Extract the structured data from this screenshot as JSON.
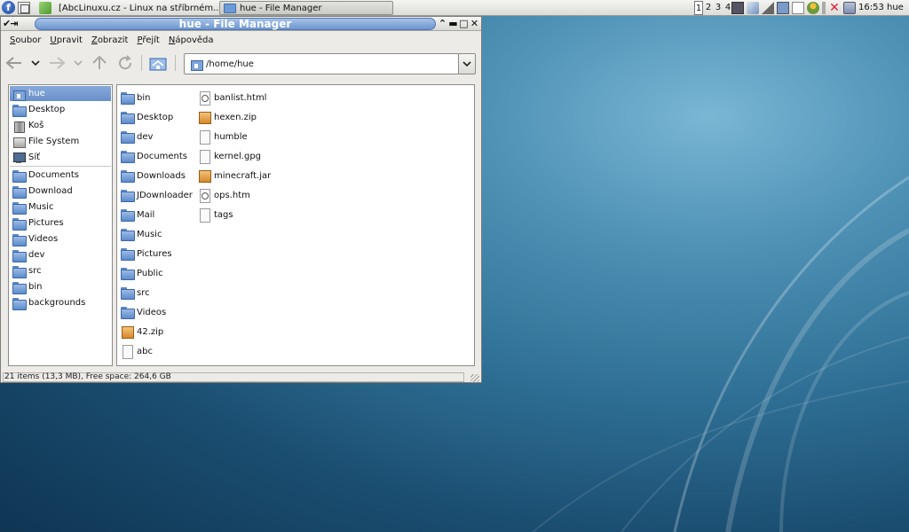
{
  "panel": {
    "menu_logo": "f",
    "taskbar": [
      {
        "label": "[AbcLinuxu.cz - Linux na stříbrném..."
      },
      {
        "label": "hue - File Manager"
      }
    ],
    "workspaces": [
      "1",
      "2",
      "3",
      "4"
    ],
    "active_workspace": "1",
    "clock": "16:53",
    "user": "hue"
  },
  "window": {
    "title": "hue - File Manager",
    "titlebar_left": "✔⇥",
    "buttons": {
      "shade": "⌃",
      "minimize": "▬",
      "maximize": "□",
      "close": "✕"
    }
  },
  "menu": [
    {
      "label": "Soubor",
      "mnemonic": "S",
      "rest": "oubor"
    },
    {
      "label": "Upravit",
      "mnemonic": "U",
      "rest": "pravit"
    },
    {
      "label": "Zobrazit",
      "mnemonic": "Z",
      "rest": "obrazit"
    },
    {
      "label": "Přejít",
      "mnemonic": "P",
      "rest": "řejít"
    },
    {
      "label": "Nápověda",
      "mnemonic": "N",
      "rest": "ápověda"
    }
  ],
  "toolbar": {
    "back_icon": "back-icon",
    "forward_icon": "forward-icon",
    "up_icon": "up-icon",
    "reload_icon": "reload-icon",
    "home_icon": "home-icon"
  },
  "address": {
    "path": "/home/hue"
  },
  "sidebar": {
    "places": [
      {
        "label": "hue",
        "icon": "home-icon",
        "selected": true
      },
      {
        "label": "Desktop",
        "icon": "desktop-folder-icon"
      },
      {
        "label": "Koš",
        "icon": "trash-icon"
      },
      {
        "label": "File System",
        "icon": "filesystem-icon"
      },
      {
        "label": "Síť",
        "icon": "network-icon"
      }
    ],
    "bookmarks": [
      {
        "label": "Documents"
      },
      {
        "label": "Download"
      },
      {
        "label": "Music"
      },
      {
        "label": "Pictures"
      },
      {
        "label": "Videos"
      },
      {
        "label": "dev"
      },
      {
        "label": "src"
      },
      {
        "label": "bin"
      },
      {
        "label": "backgrounds"
      }
    ]
  },
  "files": {
    "column1": [
      {
        "name": "bin",
        "type": "folder"
      },
      {
        "name": "Desktop",
        "type": "folder"
      },
      {
        "name": "dev",
        "type": "folder"
      },
      {
        "name": "Documents",
        "type": "folder"
      },
      {
        "name": "Downloads",
        "type": "folder"
      },
      {
        "name": "JDownloader",
        "type": "folder"
      },
      {
        "name": "Mail",
        "type": "folder"
      },
      {
        "name": "Music",
        "type": "folder"
      },
      {
        "name": "Pictures",
        "type": "folder"
      },
      {
        "name": "Public",
        "type": "folder"
      },
      {
        "name": "src",
        "type": "folder"
      },
      {
        "name": "Videos",
        "type": "folder"
      },
      {
        "name": "42.zip",
        "type": "zip"
      },
      {
        "name": "abc",
        "type": "file"
      }
    ],
    "column2": [
      {
        "name": "banlist.html",
        "type": "html"
      },
      {
        "name": "hexen.zip",
        "type": "zip"
      },
      {
        "name": "humble",
        "type": "file"
      },
      {
        "name": "kernel.gpg",
        "type": "file"
      },
      {
        "name": "minecraft.jar",
        "type": "zip"
      },
      {
        "name": "ops.htm",
        "type": "html"
      },
      {
        "name": "tags",
        "type": "file"
      }
    ]
  },
  "status": {
    "text": "21 items (13,3 MB), Free space: 264,6 GB"
  },
  "colors": {
    "selection": "#6a90c8",
    "title_pill": "#6e96cf",
    "desktop": "#2f6f95"
  }
}
